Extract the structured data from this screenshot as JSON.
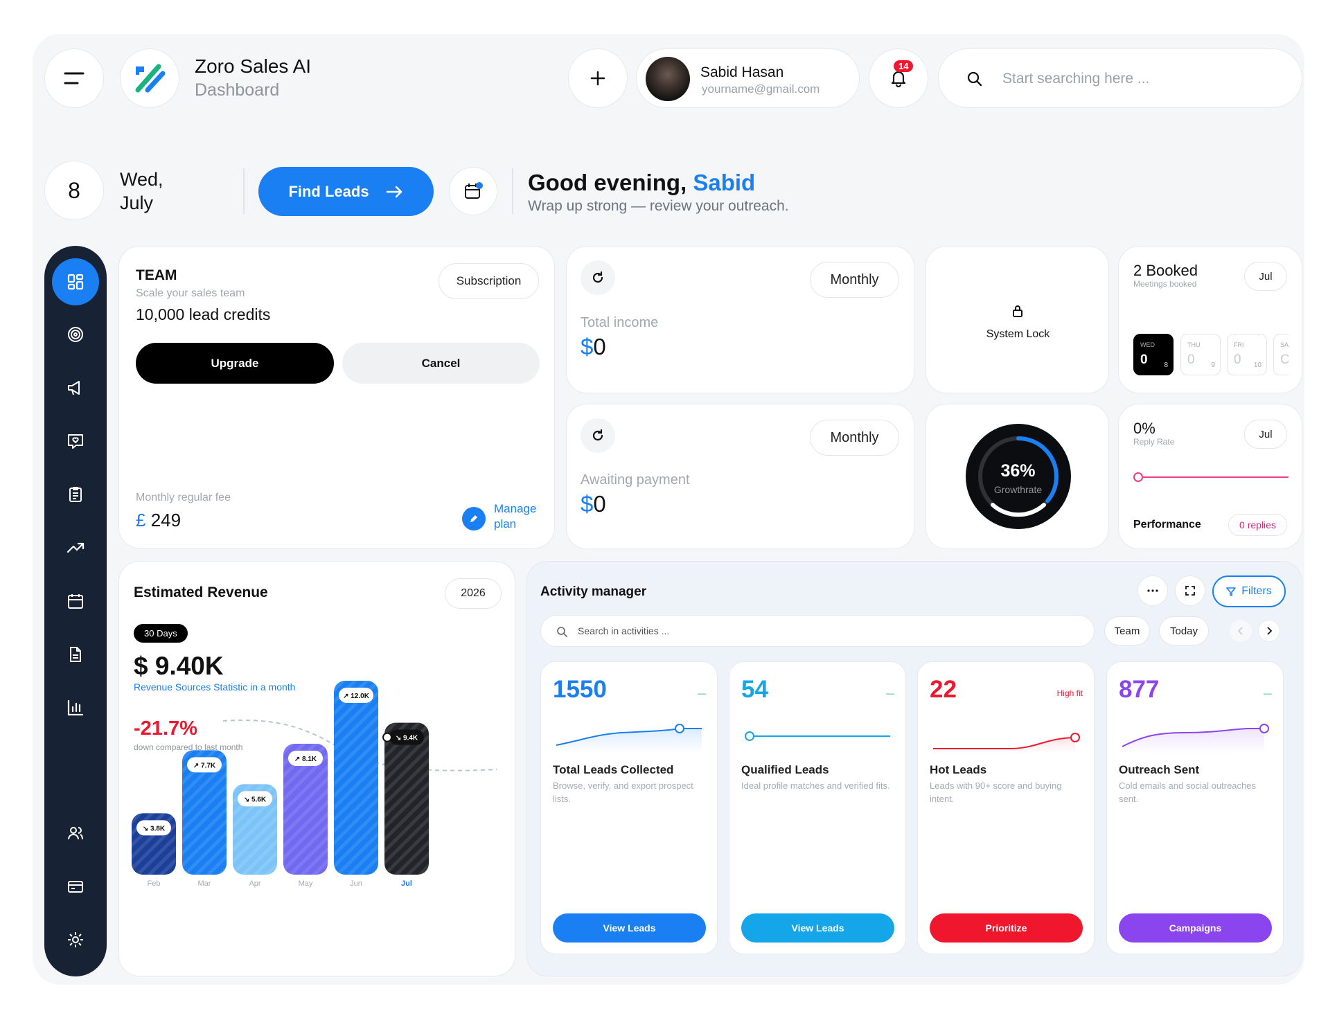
{
  "header": {
    "app_name": "Zoro Sales AI",
    "app_subtitle": "Dashboard",
    "user_name": "Sabid Hasan",
    "user_email": "yourname@gmail.com",
    "notification_count": "14",
    "search_placeholder": "Start searching here ..."
  },
  "greeting": {
    "day_number": "8",
    "weekday": "Wed,",
    "month": "July",
    "find_leads_label": "Find Leads",
    "greeting_prefix": "Good evening, ",
    "greeting_name": "Sabid",
    "subtitle": "Wrap up strong — review your outreach."
  },
  "team_card": {
    "title": "TEAM",
    "subtitle": "Scale your sales team",
    "credits": "10,000 lead credits",
    "subscription_label": "Subscription",
    "upgrade_label": "Upgrade",
    "cancel_label": "Cancel",
    "fee_label": "Monthly regular fee",
    "fee_currency": "£",
    "fee_value": "249",
    "manage_label_line1": "Manage",
    "manage_label_line2": "plan"
  },
  "income_card": {
    "period": "Monthly",
    "label": "Total income",
    "currency": "$",
    "value": "0"
  },
  "awaiting_card": {
    "period": "Monthly",
    "label": "Awaiting payment",
    "currency": "$",
    "value": "0"
  },
  "system_lock": {
    "label": "System Lock"
  },
  "growth": {
    "value": "36%",
    "label": "Growthrate",
    "fraction": 0.36
  },
  "booked_card": {
    "title": "2 Booked",
    "subtitle": "Meetings booked",
    "month": "Jul",
    "days": [
      {
        "name": "WED",
        "value": "0",
        "date": "8",
        "active": true
      },
      {
        "name": "THU",
        "value": "0",
        "date": "9",
        "active": false
      },
      {
        "name": "FRI",
        "value": "0",
        "date": "10",
        "active": false
      },
      {
        "name": "SA",
        "value": "C",
        "date": "",
        "active": false
      }
    ]
  },
  "reply_card": {
    "value": "0%",
    "label": "Reply Rate",
    "month": "Jul",
    "performance_label": "Performance",
    "replies_badge": "0 replies"
  },
  "revenue": {
    "title": "Estimated Revenue",
    "year": "2026",
    "period_badge": "30 Days",
    "total": "$ 9.40K",
    "total_caption": "Revenue Sources Statistic in a month",
    "change": "-21.7%",
    "change_caption": "down compared to last month"
  },
  "chart_data": {
    "type": "bar",
    "title": "Estimated Revenue",
    "categories": [
      "Feb",
      "Mar",
      "Apr",
      "May",
      "Jun",
      "Jul"
    ],
    "values": [
      3.8,
      7.7,
      5.6,
      8.1,
      12.0,
      9.4
    ],
    "labels": [
      "↘ 3.8K",
      "↗ 7.7K",
      "↘ 5.6K",
      "↗ 8.1K",
      "↗ 12.0K",
      "↘ 9.4K"
    ],
    "colors": [
      "#1c3f99",
      "#1a7ff2",
      "#7cc4f8",
      "#7169f0",
      "#1a7ff2",
      "#222429"
    ],
    "ylim": [
      0,
      12.0
    ]
  },
  "activity": {
    "title": "Activity manager",
    "filters_label": "Filters",
    "search_placeholder": "Search in activities ...",
    "team_chip": "Team",
    "today_chip": "Today",
    "cards": [
      {
        "value": "1550",
        "tag": "—",
        "title": "Total Leads Collected",
        "desc": "Browse, verify, and export prospect lists.",
        "button": "View Leads",
        "color": "#1a7ff2"
      },
      {
        "value": "54",
        "tag": "—",
        "title": "Qualified Leads",
        "desc": "Ideal profile matches and verified fits.",
        "button": "View Leads",
        "color": "#15a6ea"
      },
      {
        "value": "22",
        "tag": "High fit",
        "title": "Hot Leads",
        "desc": "Leads with 90+ score and buying intent.",
        "button": "Prioritize",
        "color": "#f0162d"
      },
      {
        "value": "877",
        "tag": "—",
        "title": "Outreach Sent",
        "desc": "Cold emails and social outreaches sent.",
        "button": "Campaigns",
        "color": "#8b45ef"
      }
    ]
  },
  "icons": [
    "menu-icon",
    "logo-icon",
    "plus-icon",
    "bell-icon",
    "search-icon",
    "calendar-icon",
    "dashboard-icon",
    "target-icon",
    "megaphone-icon",
    "chat-heart-icon",
    "clipboard-icon",
    "trend-icon",
    "calendar-nav-icon",
    "document-icon",
    "bar-chart-icon",
    "users-icon",
    "card-icon",
    "gear-icon",
    "refresh-icon",
    "lock-icon",
    "pencil-icon",
    "chevron-left-icon",
    "chevron-right-icon",
    "more-icon",
    "expand-icon",
    "filter-icon"
  ]
}
